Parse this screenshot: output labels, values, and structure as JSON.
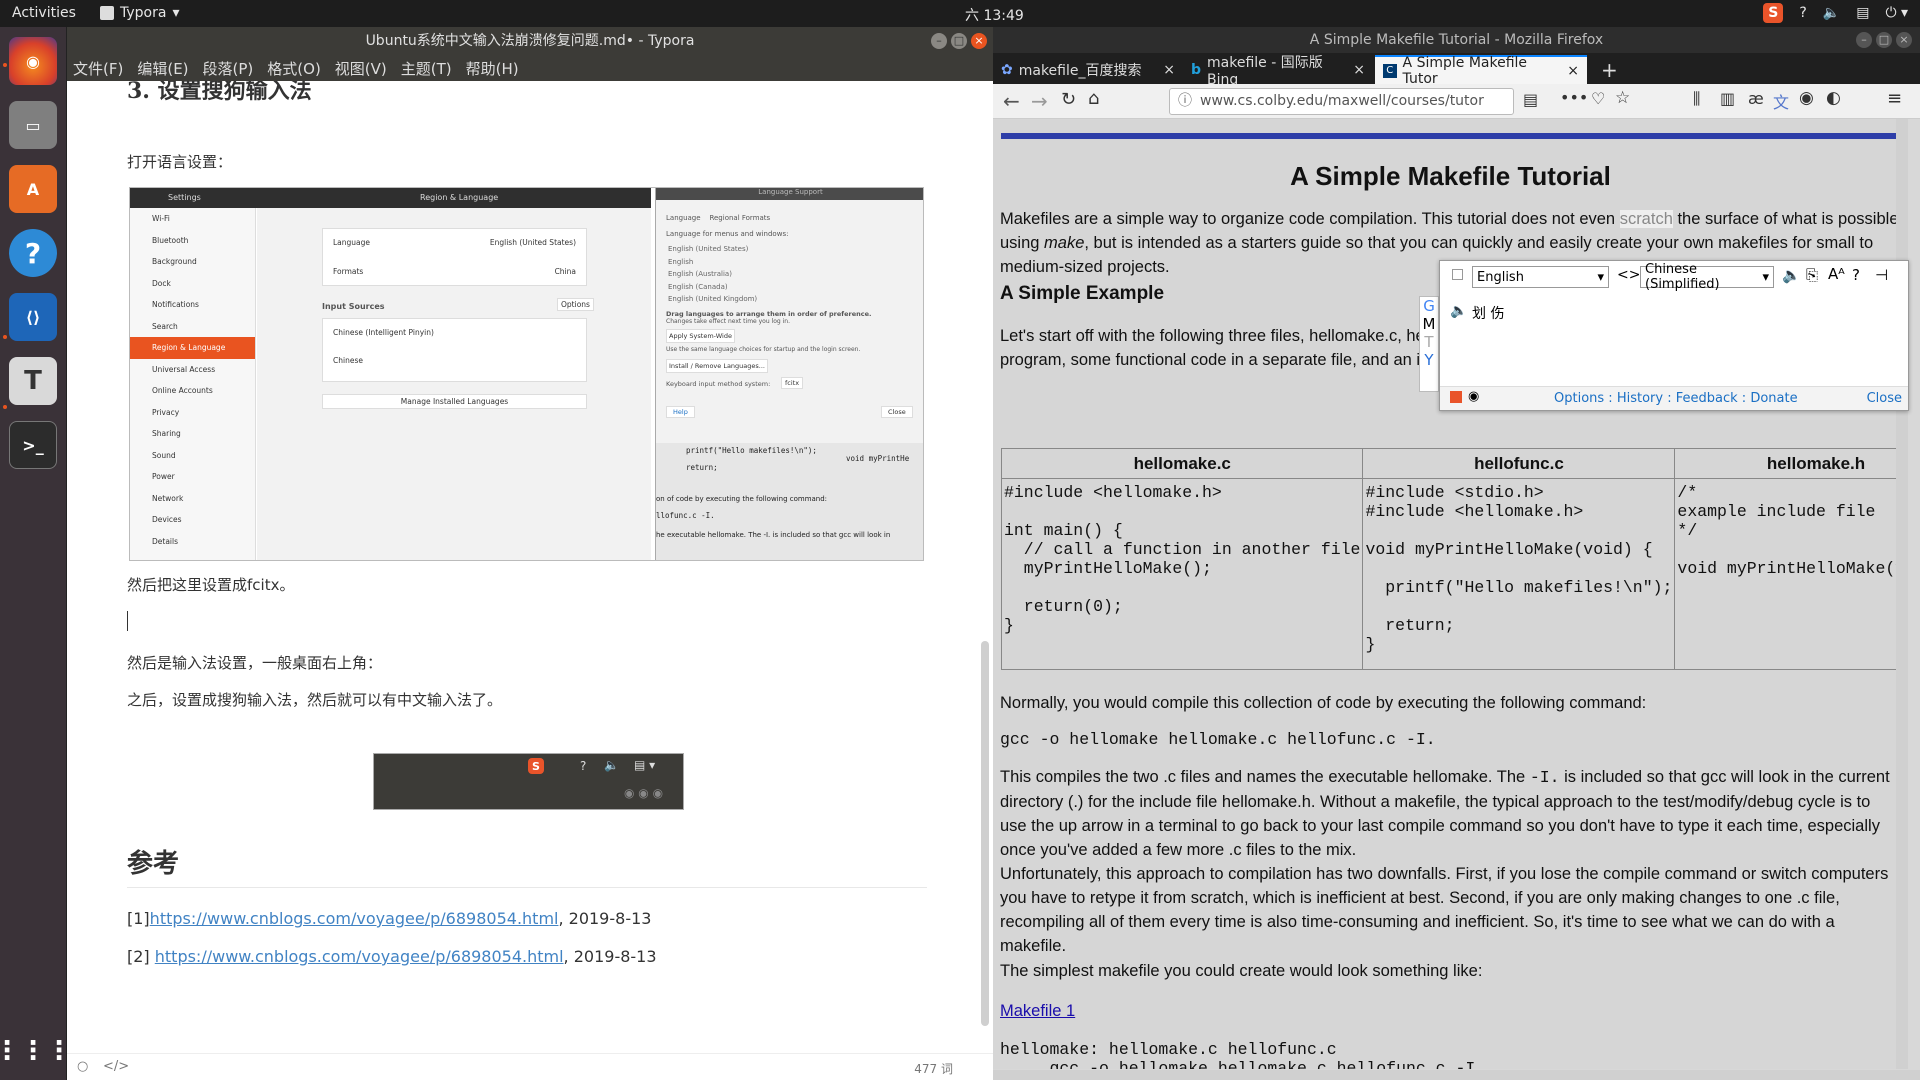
{
  "topbar": {
    "activities": "Activities",
    "app": "Typora",
    "clock": "六 13:49",
    "icons": [
      "sogou-icon",
      "help-icon",
      "volume-icon",
      "clipboard-icon",
      "power-menu-icon"
    ]
  },
  "dock": {
    "apps": [
      "firefox-icon",
      "files-icon",
      "software-icon",
      "help-icon",
      "vscode-icon",
      "typora-icon",
      "terminal-icon",
      "show-apps-icon"
    ]
  },
  "typora": {
    "title": "Ubuntu系统中文输入法崩溃修复问题.md• - Typora",
    "menu": [
      "文件(F)",
      "编辑(E)",
      "段落(P)",
      "格式(O)",
      "视图(V)",
      "主题(T)",
      "帮助(H)"
    ],
    "heading": "3. 设置搜狗输入法",
    "p1": "打开语言设置：",
    "p2": "然后把这里设置成fcitx。",
    "p3": "然后是输入法设置，一般桌面右上角：",
    "p4": "之后，设置成搜狗输入法，然后就可以有中文输入法了。",
    "h2": "参考",
    "ref1_prefix": "[1]",
    "ref1_link": "https://www.cnblogs.com/voyagee/p/6898054.html",
    "ref1_suffix": ", 2019-8-13",
    "ref2_prefix": "[2] ",
    "ref2_link": "https://www.cnblogs.com/voyagee/p/6898054.html",
    "ref2_suffix": ", 2019-8-13",
    "wordcount": "477 词",
    "screenshot": {
      "settings_title": "Settings",
      "region_title": "Region & Language",
      "sidebar": [
        "Wi-Fi",
        "Bluetooth",
        "Background",
        "Dock",
        "Notifications",
        "Search",
        "Region & Language",
        "Universal Access",
        "Online Accounts",
        "Privacy",
        "Sharing",
        "Sound",
        "Power",
        "Network",
        "Devices",
        "Details"
      ],
      "language_label": "Language",
      "language_value": "English (United States)",
      "formats_label": "Formats",
      "formats_value": "China",
      "input_sources": "Input Sources",
      "options": "Options",
      "source1": "Chinese (Intelligent Pinyin)",
      "source2": "Chinese",
      "manage": "Manage Installed Languages",
      "ls_title": "Language Support",
      "ls_tabs": [
        "Language",
        "Regional Formats"
      ],
      "ls_menu_label": "Language for menus and windows:",
      "ls_langs": [
        "English (United States)",
        "English",
        "English (Australia)",
        "English (Canada)",
        "English (United Kingdom)"
      ],
      "ls_drag": "Drag languages to arrange them in order of preference.",
      "ls_drag2": "Changes take effect next time you log in.",
      "ls_apply": "Apply System-Wide",
      "ls_apply_note": "Use the same language choices for startup and the login screen.",
      "ls_install": "Install / Remove Languages...",
      "ls_kim": "Keyboard input method system:",
      "ls_kim_val": "fcitx",
      "ls_help": "Help",
      "ls_close": "Close",
      "code1": "printf(\"Hello makefiles!\\n\");",
      "code2": "return;",
      "code3": "void myPrintHe",
      "code4": "on of code by executing the following command:",
      "code5": "llofunc.c -I.",
      "code6": "he executable hellomake. The -I. is included so that gcc will look in"
    }
  },
  "firefox": {
    "title": "A Simple Makefile Tutorial - Mozilla Firefox",
    "tabs": [
      "makefile_百度搜索",
      "makefile - 国际版 Bing",
      "A Simple Makefile Tutor"
    ],
    "url": "www.cs.colby.edu/maxwell/courses/tutor",
    "url_host": "colby.edu",
    "page": {
      "title": "A Simple Makefile Tutorial",
      "intro_a": "Makefiles are a simple way to organize code compilation. This tutorial does not even ",
      "intro_scratch": "scratch",
      "intro_b": " the surface of what is possible using ",
      "intro_make": "make",
      "intro_c": ", but is intended as a starters guide so that you can quickly and easily create your own makefiles for small to medium-sized projects.",
      "h_example": "A Simple Example",
      "ex_p": "Let's start off with the following three files, hellomake.c, hellofunc.c, and hellomake.h, which would represent a typical main program, some functional code in a separate file, and an include file, respectively.",
      "table_headers": [
        "hellomake.c",
        "hellofunc.c",
        "hellomake.h"
      ],
      "table_code": [
        "#include <hellomake.h>\n\nint main() {\n  // call a function in another file\n  myPrintHelloMake();\n\n  return(0);\n}",
        "#include <stdio.h>\n#include <hellomake.h>\n\nvoid myPrintHelloMake(void) {\n\n  printf(\"Hello makefiles!\\n\");\n\n  return;\n}",
        "/*\nexample include file\n*/\n\nvoid myPrintHelloMake(void);"
      ],
      "p_normally": "Normally, you would compile this collection of code by executing the following command:",
      "cmd": "gcc -o hellomake hellomake.c hellofunc.c -I.",
      "p_compiles_a": "This compiles the two .c files and names the executable hellomake. The ",
      "p_compiles_code": "-I.",
      "p_compiles_b": " is included so that gcc will look in the current directory (.) for the include file hellomake.h. Without a makefile, the typical approach to the test/modify/debug cycle is to use the up arrow in a terminal to go back to your last compile command so you don't have to type it each time, especially once you've added a few more .c files to the mix.",
      "p_unfortunately": "Unfortunately, this approach to compilation has two downfalls. First, if you lose the compile command or switch computers you have to retype it from scratch, which is inefficient at best. Second, if you are only making changes to one .c file, recompiling all of them every time is also time-consuming and inefficient. So, it's time to see what we can do with a makefile.",
      "p_simplest": "The simplest makefile you could create would look something like:",
      "makefile_link": "Makefile 1",
      "makefile_line1": "hellomake: hellomake.c hellofunc.c",
      "makefile_line2": "     gcc -o hellomake hellomake.c hellofunc.c -I."
    },
    "dict": {
      "from": "English",
      "to": "Chinese (Simplified)",
      "result": "划 伤",
      "side": [
        "G",
        "M",
        "T",
        "Y"
      ],
      "footer_links": [
        "Options",
        "History",
        "Feedback",
        "Donate"
      ],
      "close": "Close"
    }
  }
}
